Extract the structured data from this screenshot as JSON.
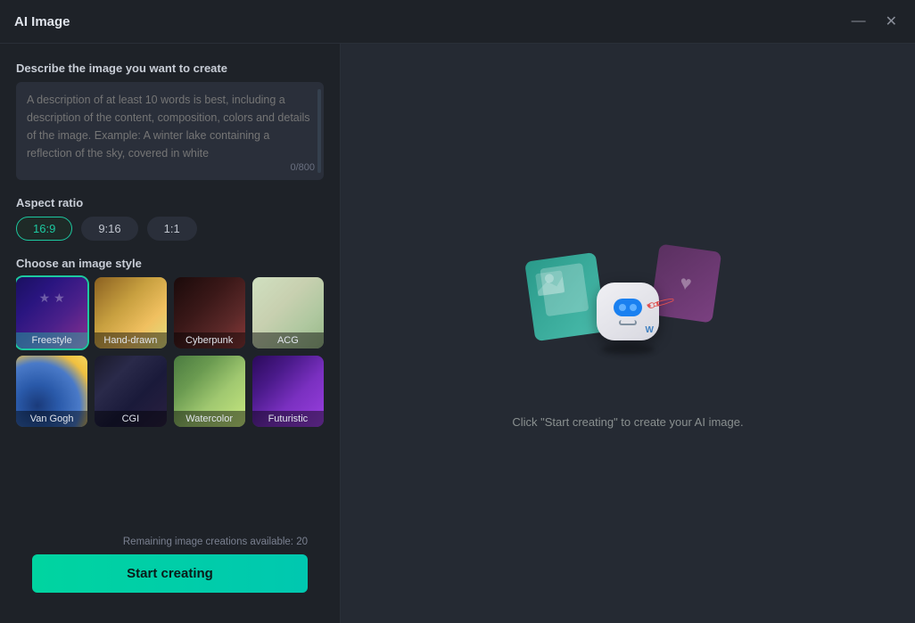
{
  "window": {
    "title": "AI Image",
    "minimize_label": "minimize",
    "close_label": "close"
  },
  "prompt_section": {
    "label": "Describe the image you want to create",
    "placeholder": "A description of at least 10 words is best, including a description of the content, composition, colors and details of the image. Example: A winter lake containing a reflection of the sky, covered in white",
    "char_count": "0/800"
  },
  "aspect_ratio": {
    "label": "Aspect ratio",
    "options": [
      {
        "value": "16:9",
        "active": true
      },
      {
        "value": "9:16",
        "active": false
      },
      {
        "value": "1:1",
        "active": false
      }
    ]
  },
  "style_section": {
    "label": "Choose an image style",
    "styles": [
      {
        "name": "Freestyle",
        "selected": true,
        "css_class": "style-freestyle"
      },
      {
        "name": "Hand-drawn",
        "selected": false,
        "css_class": "style-handdrawn"
      },
      {
        "name": "Cyberpunk",
        "selected": false,
        "css_class": "style-cyberpunk"
      },
      {
        "name": "ACG",
        "selected": false,
        "css_class": "style-acg"
      },
      {
        "name": "Van Gogh",
        "selected": false,
        "css_class": "style-vangogh"
      },
      {
        "name": "CGI",
        "selected": false,
        "css_class": "style-cgi"
      },
      {
        "name": "Watercolor",
        "selected": false,
        "css_class": "style-watercolor"
      },
      {
        "name": "Futuristic",
        "selected": false,
        "css_class": "style-futuristic"
      }
    ]
  },
  "footer": {
    "remaining_text": "Remaining image creations available: 20",
    "start_button_label": "Start creating"
  },
  "right_panel": {
    "hint_text": "Click \"Start creating\" to create your AI image."
  }
}
